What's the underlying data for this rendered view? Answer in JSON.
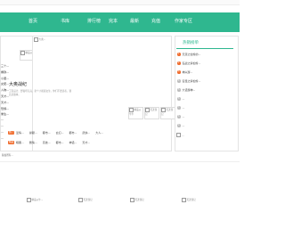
{
  "header": {
    "top_right": ""
  },
  "nav": {
    "items": [
      {
        "label": "首页"
      },
      {
        "label": "书库"
      },
      {
        "label": "排行榜"
      },
      {
        "label": "完本"
      },
      {
        "label": "最新"
      },
      {
        "label": "充值"
      },
      {
        "label": "作家专区"
      }
    ]
  },
  "left": {
    "image_alt": "精品火牛牛",
    "items": [
      "三个...",
      "爆款...",
      "小团...",
      "女配...",
      "人物...",
      "天才...",
      "天才...",
      "恐惧...",
      "重生...",
      "...",
      "...",
      "...",
      "..."
    ]
  },
  "feature": {
    "image_alt": "大奥...",
    "title": "大奥战纪",
    "description": "工程设计、野猫坦克兵、新个小姐感女生，你们不要读者，我还是故事。"
  },
  "thumbs": [
    {
      "alt": "精品火牛牛"
    },
    {
      "alt": "天涯游记"
    },
    {
      "alt": "天涯游记"
    }
  ],
  "tag_rows": [
    {
      "tag": "热门",
      "tag_color": "#f06b2c",
      "items": [
        "爱情...",
        "悬疑...",
        "都市...",
        "玄幻...",
        "都市...",
        "武侠...",
        "大人..."
      ]
    },
    {
      "tag": "精品",
      "tag_color": "#f06b2c",
      "items": [
        "暗黑...",
        "剧情...",
        "竞技...",
        "都市...",
        "神话...",
        "天才..."
      ]
    }
  ],
  "right": {
    "title": "热销榜单",
    "ranks": [
      {
        "n": "1",
        "text": "天涯之怕怜的..."
      },
      {
        "n": "2",
        "text": "狂战之情怕怜..."
      },
      {
        "n": "3",
        "text": "神兴游..."
      },
      {
        "n": "4",
        "text": "狂怪之情怕怜..."
      },
      {
        "n": "5",
        "text": "大话游神..."
      },
      {
        "n": "6",
        "text": "..."
      },
      {
        "n": "7",
        "text": "..."
      },
      {
        "n": "8",
        "text": "..."
      },
      {
        "n": "9",
        "text": "..."
      }
    ],
    "small": [
      "..."
    ]
  },
  "footer": {
    "text": "版权所有..."
  },
  "bottom_cards": [
    {
      "alt": "精品火牛..."
    },
    {
      "alt": "天涯游记"
    },
    {
      "alt": "天涯游记"
    },
    {
      "alt": "天涯游记"
    }
  ]
}
